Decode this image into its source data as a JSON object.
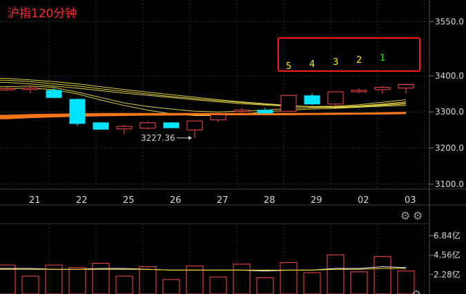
{
  "title": "沪指120分钟",
  "colors": {
    "up": "#ff4a4a",
    "down": "#00e5ff",
    "grid": "#2e2e2e",
    "ma_yellow": "#e8d84a",
    "ma_orange": "#ff7a1a",
    "vol_white": "#ffffff",
    "vol_yellow": "#ffdd33"
  },
  "icons": {
    "price_settings": "gear-icon",
    "volume_settings": "gear-icon"
  },
  "chart_data": {
    "type": "candlestick",
    "price_axis": {
      "ticks": [
        "3550.0",
        "3400.0",
        "3300.0",
        "3200.0",
        "3100.0"
      ],
      "tick_values": [
        3550,
        3400,
        3300,
        3200,
        3100
      ],
      "ylim": [
        3090,
        3595
      ]
    },
    "x_ticks": [
      {
        "label": "21",
        "index": 1
      },
      {
        "label": "22",
        "index": 3
      },
      {
        "label": "25",
        "index": 5
      },
      {
        "label": "26",
        "index": 7
      },
      {
        "label": "27",
        "index": 9
      },
      {
        "label": "28",
        "index": 11
      },
      {
        "label": "29",
        "index": 13
      },
      {
        "label": "02",
        "index": 15
      },
      {
        "label": "03",
        "index": 17
      }
    ],
    "candles": [
      {
        "o": 3362,
        "h": 3372,
        "l": 3358,
        "c": 3365
      },
      {
        "o": 3363,
        "h": 3372,
        "l": 3352,
        "c": 3366
      },
      {
        "o": 3360,
        "h": 3366,
        "l": 3338,
        "c": 3340
      },
      {
        "o": 3335,
        "h": 3338,
        "l": 3262,
        "c": 3268
      },
      {
        "o": 3270,
        "h": 3272,
        "l": 3250,
        "c": 3252
      },
      {
        "o": 3253,
        "h": 3264,
        "l": 3238,
        "c": 3260
      },
      {
        "o": 3255,
        "h": 3275,
        "l": 3252,
        "c": 3270
      },
      {
        "o": 3270,
        "h": 3272,
        "l": 3255,
        "c": 3256
      },
      {
        "o": 3250,
        "h": 3270,
        "l": 3228,
        "c": 3275
      },
      {
        "o": 3278,
        "h": 3295,
        "l": 3272,
        "c": 3292
      },
      {
        "o": 3302,
        "h": 3310,
        "l": 3295,
        "c": 3305
      },
      {
        "o": 3305,
        "h": 3312,
        "l": 3300,
        "c": 3297
      },
      {
        "o": 3302,
        "h": 3348,
        "l": 3300,
        "c": 3346
      },
      {
        "o": 3345,
        "h": 3352,
        "l": 3318,
        "c": 3322
      },
      {
        "o": 3322,
        "h": 3358,
        "l": 3315,
        "c": 3356
      },
      {
        "o": 3356,
        "h": 3366,
        "l": 3352,
        "c": 3360
      },
      {
        "o": 3362,
        "h": 3372,
        "l": 3350,
        "c": 3368
      },
      {
        "o": 3366,
        "h": 3380,
        "l": 3352,
        "c": 3376
      }
    ],
    "moving_averages": [
      {
        "color": "ma_yellow",
        "values": [
          3382,
          3378,
          3372,
          3366,
          3359,
          3352,
          3346,
          3340,
          3334,
          3328,
          3323,
          3319,
          3316,
          3315,
          3316,
          3320,
          3327,
          3334
        ]
      },
      {
        "color": "ma_yellow",
        "values": [
          3388,
          3384,
          3378,
          3372,
          3364,
          3357,
          3350,
          3343,
          3337,
          3331,
          3326,
          3321,
          3317,
          3314,
          3314,
          3317,
          3322,
          3328
        ]
      },
      {
        "color": "ma_yellow",
        "values": [
          3393,
          3389,
          3384,
          3378,
          3370,
          3362,
          3355,
          3348,
          3341,
          3334,
          3328,
          3323,
          3318,
          3314,
          3312,
          3314,
          3318,
          3322
        ]
      },
      {
        "color": "ma_yellow",
        "values": [
          3370,
          3372,
          3368,
          3355,
          3340,
          3325,
          3315,
          3308,
          3302,
          3300,
          3302,
          3305,
          3310,
          3312,
          3313,
          3316,
          3320,
          3325
        ]
      },
      {
        "color": "ma_yellow",
        "values": [
          3365,
          3366,
          3362,
          3350,
          3333,
          3318,
          3305,
          3295,
          3290,
          3290,
          3294,
          3300,
          3305,
          3308,
          3310,
          3313,
          3316,
          3318
        ]
      },
      {
        "color": "ma_orange",
        "values": [
          3290,
          3292,
          3293,
          3294,
          3295,
          3295,
          3295,
          3295,
          3295,
          3295,
          3295,
          3295,
          3295,
          3295,
          3296,
          3296,
          3297,
          3298
        ]
      },
      {
        "color": "ma_orange",
        "values": [
          3286,
          3288,
          3290,
          3291,
          3292,
          3293,
          3293,
          3293,
          3294,
          3294,
          3294,
          3294,
          3294,
          3294,
          3295,
          3295,
          3296,
          3297
        ]
      },
      {
        "color": "ma_orange",
        "values": [
          3282,
          3285,
          3287,
          3289,
          3290,
          3291,
          3292,
          3292,
          3293,
          3293,
          3293,
          3293,
          3293,
          3294,
          3294,
          3295,
          3295,
          3296
        ]
      }
    ],
    "low_annotation": {
      "text": "3227.36",
      "candle_index": 8
    },
    "marker_labels": [
      {
        "text": "5",
        "candle_index": 12,
        "color": "#ffee00"
      },
      {
        "text": "4",
        "candle_index": 13,
        "color": "#ffee00"
      },
      {
        "text": "3",
        "candle_index": 14,
        "color": "#ffee00"
      },
      {
        "text": "2",
        "candle_index": 15,
        "color": "#ffee00"
      },
      {
        "text": "1",
        "candle_index": 16,
        "color": "#33dd33"
      }
    ],
    "volume_axis": {
      "ticks": [
        "6.84亿",
        "4.56亿",
        "2.28亿"
      ],
      "tick_values": [
        6.84,
        4.56,
        2.28
      ],
      "ylim": [
        0,
        8.1
      ]
    },
    "volume": [
      3.4,
      2.1,
      3.4,
      3.1,
      3.6,
      2.1,
      3.2,
      1.7,
      3.3,
      2.0,
      3.5,
      1.9,
      3.7,
      2.5,
      4.6,
      2.6,
      4.4,
      2.7
    ],
    "volume_ma": [
      {
        "color": "vol_white",
        "values": [
          3.0,
          3.0,
          2.9,
          2.9,
          3.0,
          3.0,
          2.9,
          2.8,
          2.8,
          2.8,
          2.8,
          2.7,
          2.8,
          2.8,
          3.0,
          3.0,
          3.2,
          3.1
        ]
      },
      {
        "color": "vol_yellow",
        "values": [
          2.9,
          2.9,
          2.9,
          2.9,
          2.9,
          2.9,
          2.9,
          2.8,
          2.8,
          2.8,
          2.8,
          2.8,
          2.8,
          2.8,
          2.9,
          2.9,
          3.0,
          3.0
        ]
      }
    ]
  }
}
